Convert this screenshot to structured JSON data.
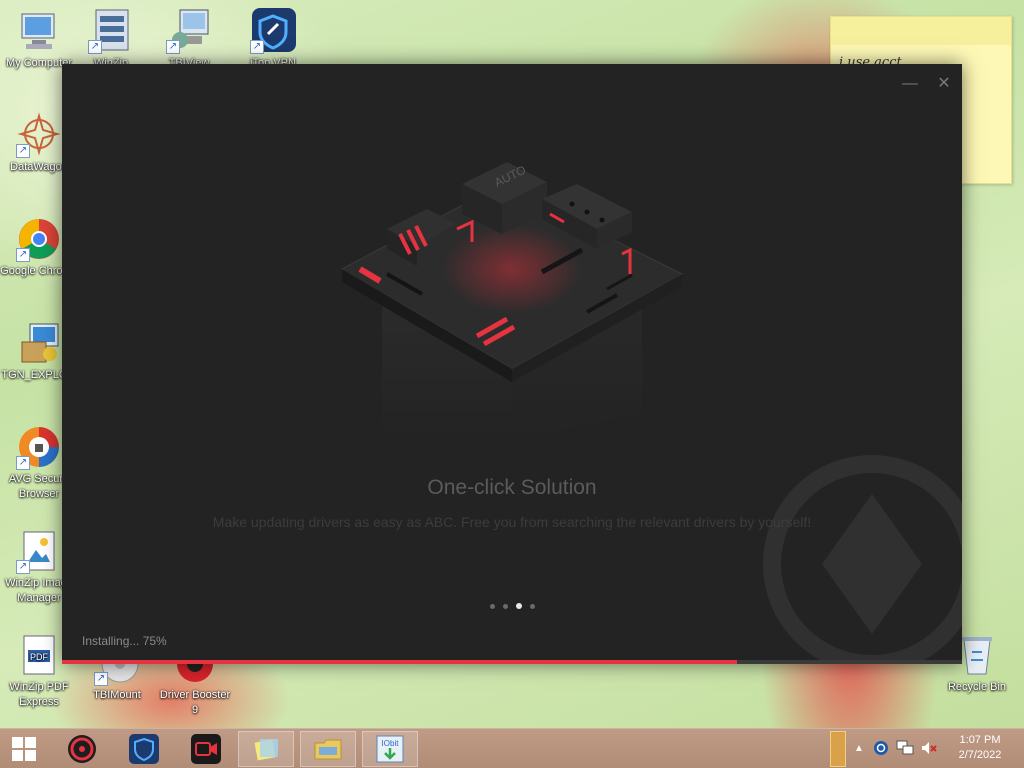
{
  "desktop": {
    "icons": [
      {
        "label": "My Computer"
      },
      {
        "label": "WinZip"
      },
      {
        "label": "TBIView"
      },
      {
        "label": "iTop VPN"
      },
      {
        "label": "DataWagon"
      },
      {
        "label": "Google Chrome"
      },
      {
        "label": "TGN_EXPLO..."
      },
      {
        "label": "AVG Secure Browser"
      },
      {
        "label": "WinZip Image Manager"
      },
      {
        "label": "WinZip PDF Express"
      },
      {
        "label": "TBIMount"
      },
      {
        "label": "Driver Booster 9"
      },
      {
        "label": "Recycle Bin"
      }
    ],
    "sticky_note_text": "i use acct..."
  },
  "installer": {
    "hero_badge": "AUTO",
    "slide_title": "One-click Solution",
    "slide_description": "Make updating drivers as easy as ABC. Free you from searching the relevant drivers by yourself!",
    "carousel_total": 4,
    "carousel_active": 3,
    "status_text": "Installing... 75%",
    "progress_percent": 75,
    "accent_color": "#e5333f"
  },
  "taskbar": {
    "apps": [
      {
        "icon": "windows-start-icon"
      },
      {
        "icon": "driver-booster-icon"
      },
      {
        "icon": "itop-vpn-icon"
      },
      {
        "icon": "screen-recorder-icon"
      },
      {
        "icon": "sticky-notes-icon"
      },
      {
        "icon": "file-explorer-icon"
      },
      {
        "icon": "iobit-installer-icon"
      }
    ],
    "time": "1:07 PM",
    "date": "2/7/2022"
  }
}
